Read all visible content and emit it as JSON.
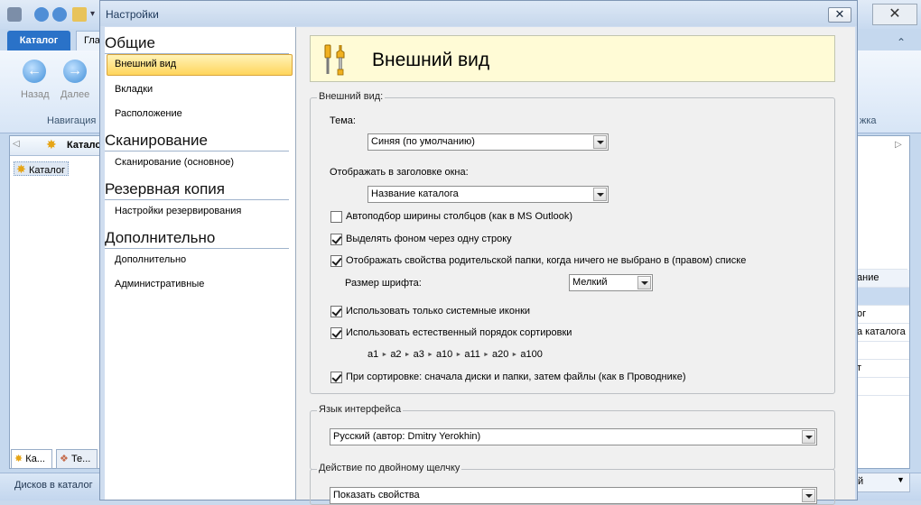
{
  "background_app": {
    "ribbon_tabs": [
      "Каталог",
      "Гла"
    ],
    "nav_buttons": {
      "back": "Назад",
      "forward": "Далее"
    },
    "group_label": "Навигация",
    "right_group_label": "жка",
    "left_pane": {
      "header_label": "Катало",
      "tree_item": "Каталог"
    },
    "bottom_tabs": [
      "Ка...",
      "Те..."
    ],
    "status_text": "Дисков в каталог",
    "right_pane": {
      "header": "ание",
      "rows": [
        "ог",
        "а каталога",
        "т"
      ],
      "scroll_text": "й"
    }
  },
  "dialog": {
    "title": "Настройки",
    "nav": [
      {
        "header": "Общие",
        "items": [
          {
            "label": "Внешний вид",
            "selected": true
          },
          {
            "label": "Вкладки"
          },
          {
            "label": "Расположение"
          }
        ]
      },
      {
        "header": "Сканирование",
        "items": [
          {
            "label": "Сканирование (основное)"
          }
        ]
      },
      {
        "header": "Резервная копия",
        "items": [
          {
            "label": "Настройки резервирования"
          }
        ]
      },
      {
        "header": "Дополнительно",
        "items": [
          {
            "label": "Дополнительно"
          },
          {
            "label": "Административные"
          }
        ]
      }
    ],
    "page_title": "Внешний вид",
    "appearance_group": {
      "legend": "Внешний вид:",
      "theme_label": "Тема:",
      "theme_value": "Синяя (по умолчанию)",
      "window_title_label": "Отображать в заголовке окна:",
      "window_title_value": "Название каталога",
      "checkboxes": [
        {
          "label": "Автоподбор ширины столбцов (как в MS Outlook)",
          "checked": false
        },
        {
          "label": "Выделять фоном через одну строку",
          "checked": true
        },
        {
          "label": "Отображать свойства родительской папки, когда ничего не выбрано в (правом) списке",
          "checked": true
        }
      ],
      "font_size_label": "Размер шрифта:",
      "font_size_value": "Мелкий",
      "checkboxes2": [
        {
          "label": "Использовать только системные иконки",
          "checked": true
        },
        {
          "label": "Использовать естественный порядок сортировки",
          "checked": true
        }
      ],
      "sort_example": [
        "a1",
        "a2",
        "a3",
        "a10",
        "a11",
        "a20",
        "a100"
      ],
      "checkbox_last": {
        "label": "При сортировке: сначала диски и папки, затем файлы (как в Проводнике)",
        "checked": true
      }
    },
    "language_group": {
      "legend": "Язык интерфейса",
      "value": "Русский (автор: Dmitry Yerokhin)"
    },
    "dblclick_group": {
      "legend": "Действие по двойному щелчку",
      "value": "Показать свойства"
    }
  }
}
